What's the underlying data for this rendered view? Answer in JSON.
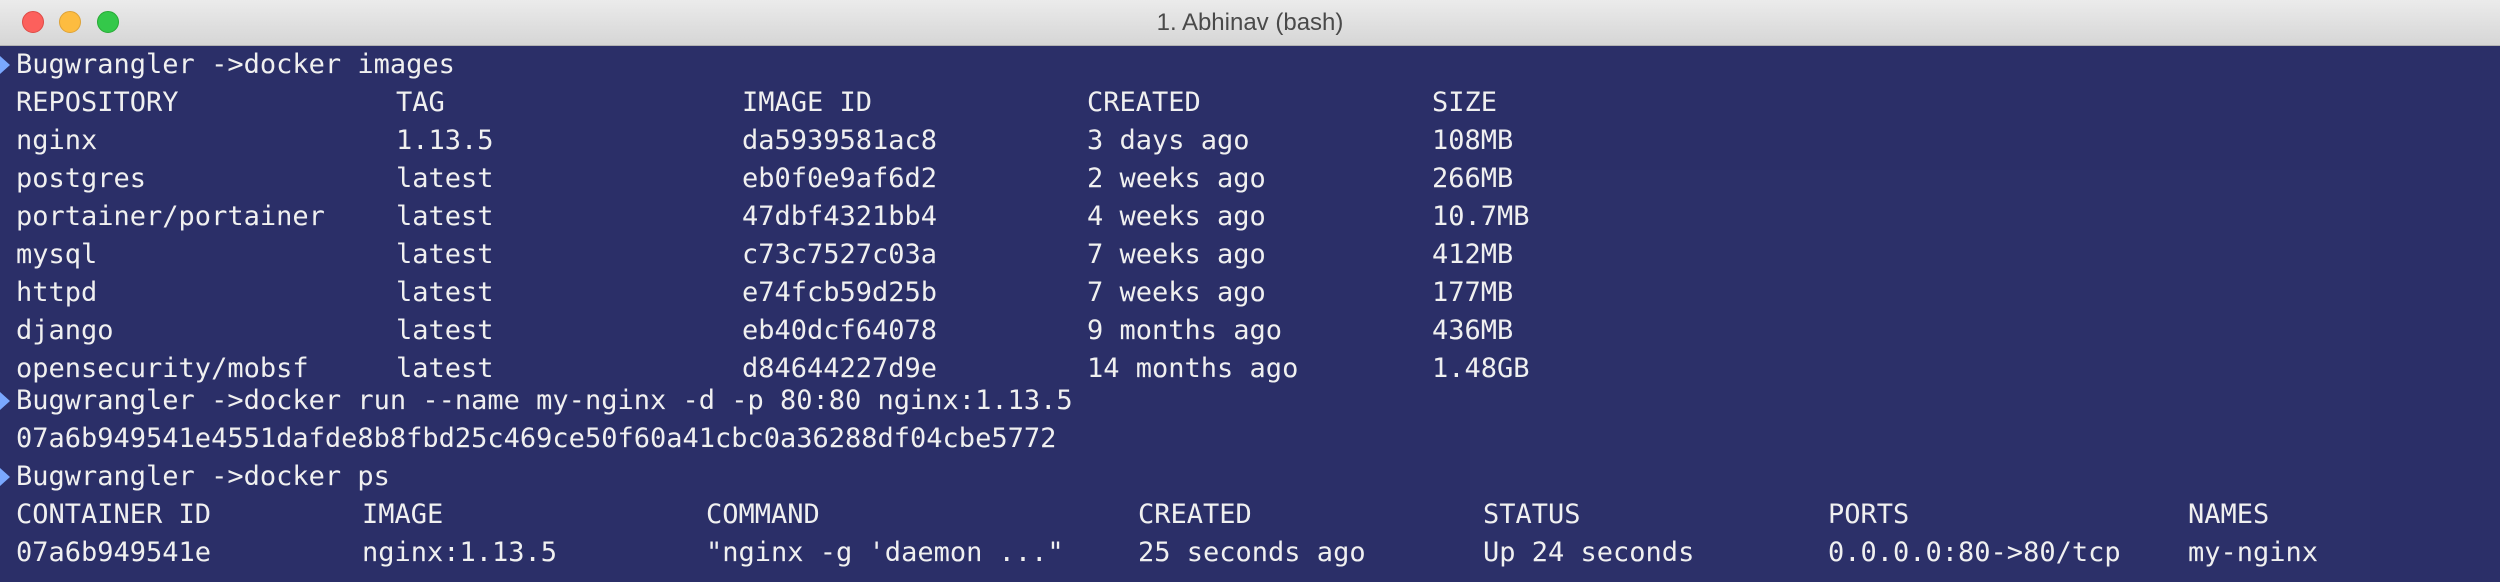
{
  "window": {
    "title": "1. Abhinav (bash)"
  },
  "colors": {
    "background": "#2e3267",
    "text": "#f0f0f0",
    "prompt_marker": "#7aa8ff"
  },
  "terminal": {
    "cmd1": "Bugwrangler ->docker images",
    "images_header": [
      "REPOSITORY",
      "TAG",
      "IMAGE ID",
      "CREATED",
      "SIZE"
    ],
    "images": [
      [
        "nginx",
        "1.13.5",
        "da5939581ac8",
        "3 days ago",
        "108MB"
      ],
      [
        "postgres",
        "latest",
        "eb0f0e9af6d2",
        "2 weeks ago",
        "266MB"
      ],
      [
        "portainer/portainer",
        "latest",
        "47dbf4321bb4",
        "4 weeks ago",
        "10.7MB"
      ],
      [
        "mysql",
        "latest",
        "c73c7527c03a",
        "7 weeks ago",
        "412MB"
      ],
      [
        "httpd",
        "latest",
        "e74fcb59d25b",
        "7 weeks ago",
        "177MB"
      ],
      [
        "django",
        "latest",
        "eb40dcf64078",
        "9 months ago",
        "436MB"
      ],
      [
        "opensecurity/mobsf",
        "latest",
        "d84644227d9e",
        "14 months ago",
        "1.48GB"
      ]
    ],
    "cmd2": "Bugwrangler ->docker run --name my-nginx -d -p 80:80 nginx:1.13.5",
    "container_hash": "07a6b949541e4551dafde8b8fbd25c469ce50f60a41cbc0a36288df04cbe5772",
    "cmd3": "Bugwrangler ->docker ps",
    "ps_header": [
      "CONTAINER ID",
      "IMAGE",
      "COMMAND",
      "CREATED",
      "STATUS",
      "PORTS",
      "NAMES"
    ],
    "ps_rows": [
      [
        "07a6b949541e",
        "nginx:1.13.5",
        "\"nginx -g 'daemon ...\"",
        "25 seconds ago",
        "Up 24 seconds",
        "0.0.0.0:80->80/tcp",
        "my-nginx"
      ]
    ]
  }
}
